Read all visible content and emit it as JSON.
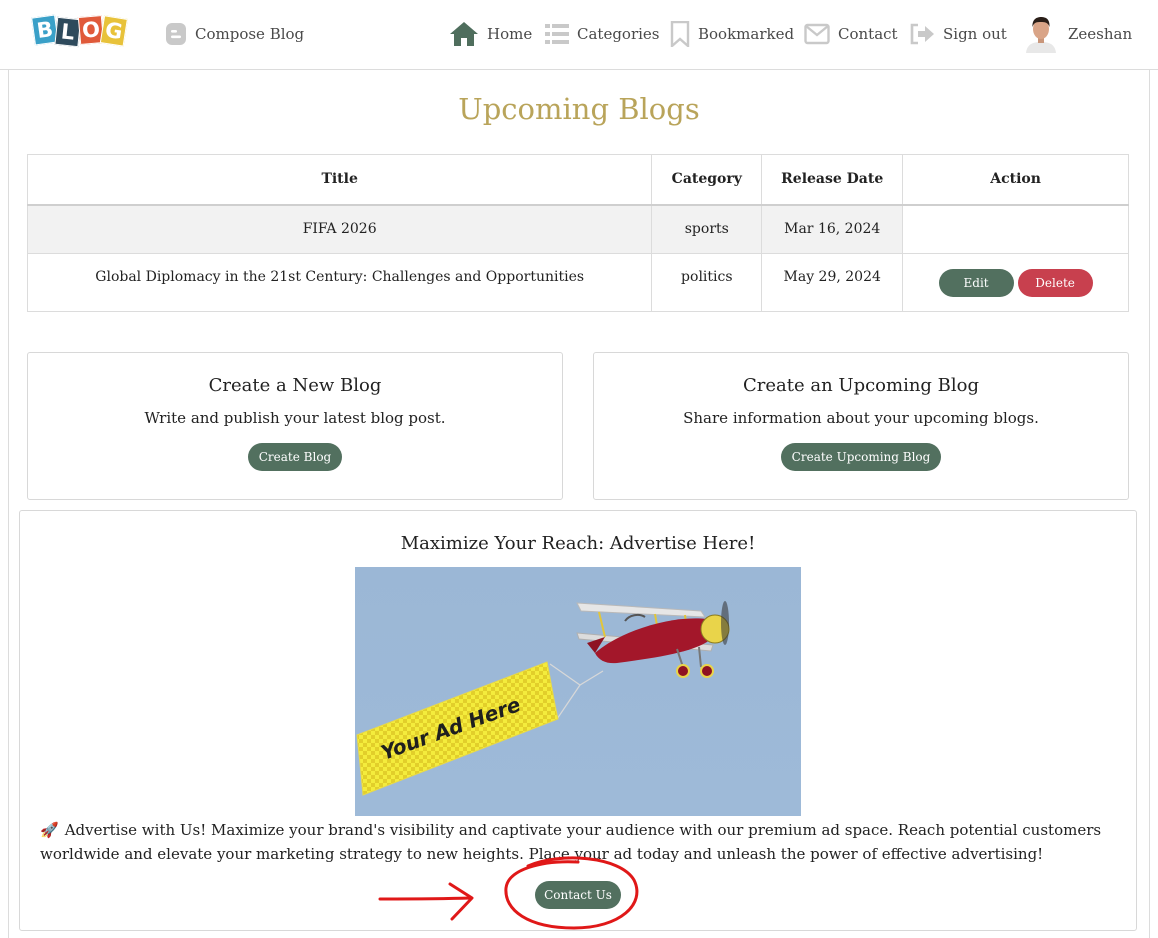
{
  "navbar": {
    "logo_letters": [
      "B",
      "L",
      "O",
      "G"
    ],
    "logo_colors": [
      "#3aa0c8",
      "#2e4a5c",
      "#e05a3a",
      "#e8c23a"
    ],
    "compose_label": "Compose Blog",
    "home_label": "Home",
    "categories_label": "Categories",
    "bookmarked_label": "Bookmarked",
    "contact_label": "Contact",
    "signout_label": "Sign out",
    "user_name": "Zeeshan"
  },
  "page": {
    "title": "Upcoming Blogs"
  },
  "table": {
    "headers": [
      "Title",
      "Category",
      "Release Date",
      "Action"
    ],
    "rows": [
      {
        "title": "FIFA 2026",
        "category": "sports",
        "release_date": "Mar 16, 2024"
      },
      {
        "title": "Global Diplomacy in the 21st Century: Challenges and Opportunities",
        "category": "politics",
        "release_date": "May 29, 2024",
        "edit_label": "Edit",
        "delete_label": "Delete"
      }
    ]
  },
  "cards": [
    {
      "title": "Create a New Blog",
      "description": "Write and publish your latest blog post.",
      "button": "Create Blog"
    },
    {
      "title": "Create an Upcoming Blog",
      "description": "Share information about your upcoming blogs.",
      "button": "Create Upcoming Blog"
    }
  ],
  "advert": {
    "heading": "Maximize Your Reach: Advertise Here!",
    "banner_text": "Your Ad Here",
    "emoji": "🚀",
    "body": "Advertise with Us! Maximize your brand's visibility and captivate your audience with our premium ad space. Reach potential customers worldwide and elevate your marketing strategy to new heights. Place your ad today and unleash the power of effective advertising!",
    "button": "Contact Us"
  },
  "colors": {
    "accent_title": "#b9a45a",
    "button_green": "#52705f",
    "button_red": "#c8404e",
    "annotation_red": "#e01818"
  }
}
